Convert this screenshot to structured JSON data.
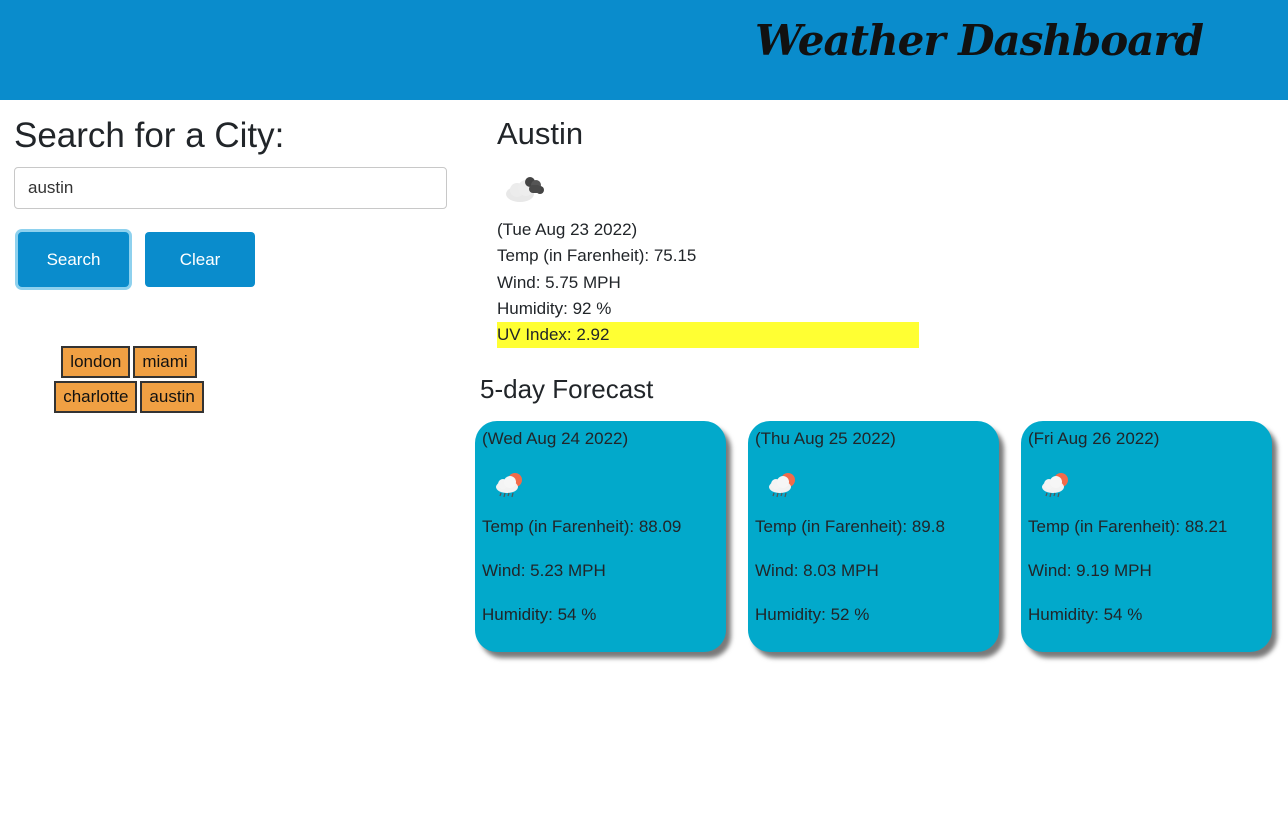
{
  "header": {
    "title": "Weather Dashboard"
  },
  "search": {
    "heading": "Search for a City:",
    "input_value": "austin",
    "search_label": "Search",
    "clear_label": "Clear"
  },
  "history": [
    "london",
    "miami",
    "charlotte",
    "austin"
  ],
  "current": {
    "city": "Austin",
    "icon": "cloudy-icon",
    "date": "(Tue Aug 23 2022)",
    "temp": "Temp (in Farenheit): 75.15",
    "wind": "Wind: 5.75 MPH",
    "humidity": "Humidity: 92 %",
    "uv": "UV Index: 2.92",
    "uv_color": "#ffff33"
  },
  "forecast": {
    "heading": "5-day Forecast",
    "days": [
      {
        "date": "(Wed Aug 24 2022)",
        "icon": "rain-sun-icon",
        "temp": "Temp (in Farenheit): 88.09",
        "wind": "Wind: 5.23 MPH",
        "humidity": "Humidity: 54 %"
      },
      {
        "date": "(Thu Aug 25 2022)",
        "icon": "rain-sun-icon",
        "temp": "Temp (in Farenheit): 89.8",
        "wind": "Wind: 8.03 MPH",
        "humidity": "Humidity: 52 %"
      },
      {
        "date": "(Fri Aug 26 2022)",
        "icon": "rain-sun-icon",
        "temp": "Temp (in Farenheit): 88.21",
        "wind": "Wind: 9.19 MPH",
        "humidity": "Humidity: 54 %"
      }
    ]
  },
  "colors": {
    "header_bg": "#0a8ccc",
    "button_bg": "#0a8ccc",
    "history_bg": "#f0a043",
    "card_bg": "#02a9cb"
  }
}
